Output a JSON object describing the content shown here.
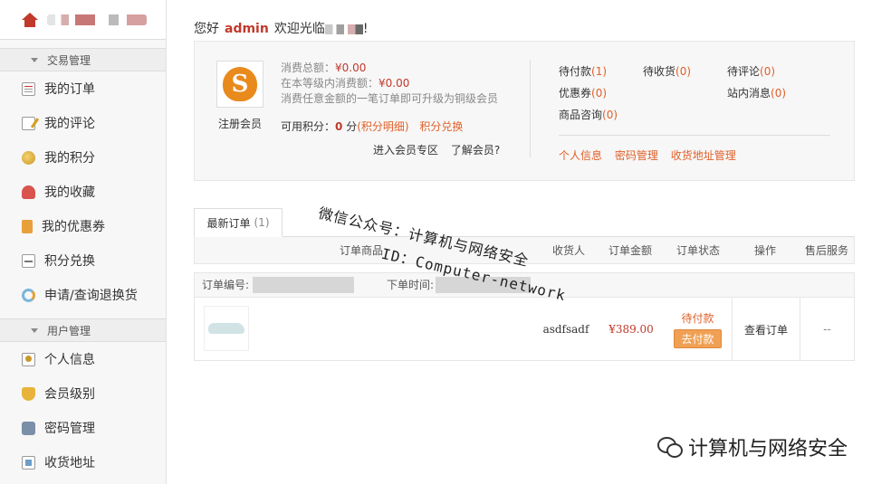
{
  "sidebar": {
    "groups": [
      {
        "title": "交易管理",
        "items": [
          {
            "label": "我的订单",
            "icon": "order-icon"
          },
          {
            "label": "我的评论",
            "icon": "review-icon"
          },
          {
            "label": "我的积分",
            "icon": "points-icon"
          },
          {
            "label": "我的收藏",
            "icon": "favorite-icon"
          },
          {
            "label": "我的优惠券",
            "icon": "coupon-icon"
          },
          {
            "label": "积分兑换",
            "icon": "exchange-icon"
          },
          {
            "label": "申请/查询退换货",
            "icon": "refund-icon"
          }
        ]
      },
      {
        "title": "用户管理",
        "items": [
          {
            "label": "个人信息",
            "icon": "user-info-icon"
          },
          {
            "label": "会员级别",
            "icon": "member-level-icon"
          },
          {
            "label": "密码管理",
            "icon": "password-icon"
          },
          {
            "label": "收货地址",
            "icon": "address-icon"
          }
        ]
      }
    ]
  },
  "greeting": {
    "prefix": "您好",
    "username": "admin",
    "welcome": "欢迎光临",
    "suffix": "!"
  },
  "member": {
    "type": "注册会员",
    "total_spend_label": "消费总额：",
    "total_spend": "¥0.00",
    "level_spend_label": "在本等级内消费额：",
    "level_spend": "¥0.00",
    "upgrade_hint": "消费任意金额的一笔订单即可升级为铜级会员",
    "points_label": "可用积分：",
    "points_value": "0",
    "points_unit": "分",
    "points_detail_link": "(积分明细)",
    "points_exchange_link": "积分兑换",
    "member_zone_link": "进入会员专区",
    "learn_member_link": "了解会员?"
  },
  "stats": {
    "pending_payment": {
      "label": "待付款",
      "count": "(1)"
    },
    "pending_receipt": {
      "label": "待收货",
      "count": "(0)"
    },
    "pending_review": {
      "label": "待评论",
      "count": "(0)"
    },
    "coupons": {
      "label": "优惠券",
      "count": "(0)"
    },
    "messages": {
      "label": "站内消息",
      "count": "(0)"
    },
    "consults": {
      "label": "商品咨询",
      "count": "(0)"
    }
  },
  "account_links": [
    "个人信息",
    "密码管理",
    "收货地址管理"
  ],
  "orders": {
    "tab_label": "最新订单",
    "tab_count": "(1)",
    "columns": [
      "订单商品",
      "收货人",
      "订单金额",
      "订单状态",
      "操作",
      "售后服务"
    ],
    "order_no_label": "订单编号:",
    "order_time_label": "下单时间:",
    "rows": [
      {
        "receiver": "asdfsadf",
        "amount": "¥389.00",
        "status": "待付款",
        "pay_button": "去付款",
        "action": "查看订单",
        "after_sale": "--"
      }
    ]
  },
  "watermark": {
    "line1": "微信公众号：计算机与网络安全",
    "line2": "ID：Computer-network"
  },
  "footer_brand": "计算机与网络安全",
  "colors": {
    "accent_red": "#c0392b",
    "link_orange": "#e0602a",
    "pay_button": "#f0a054"
  }
}
